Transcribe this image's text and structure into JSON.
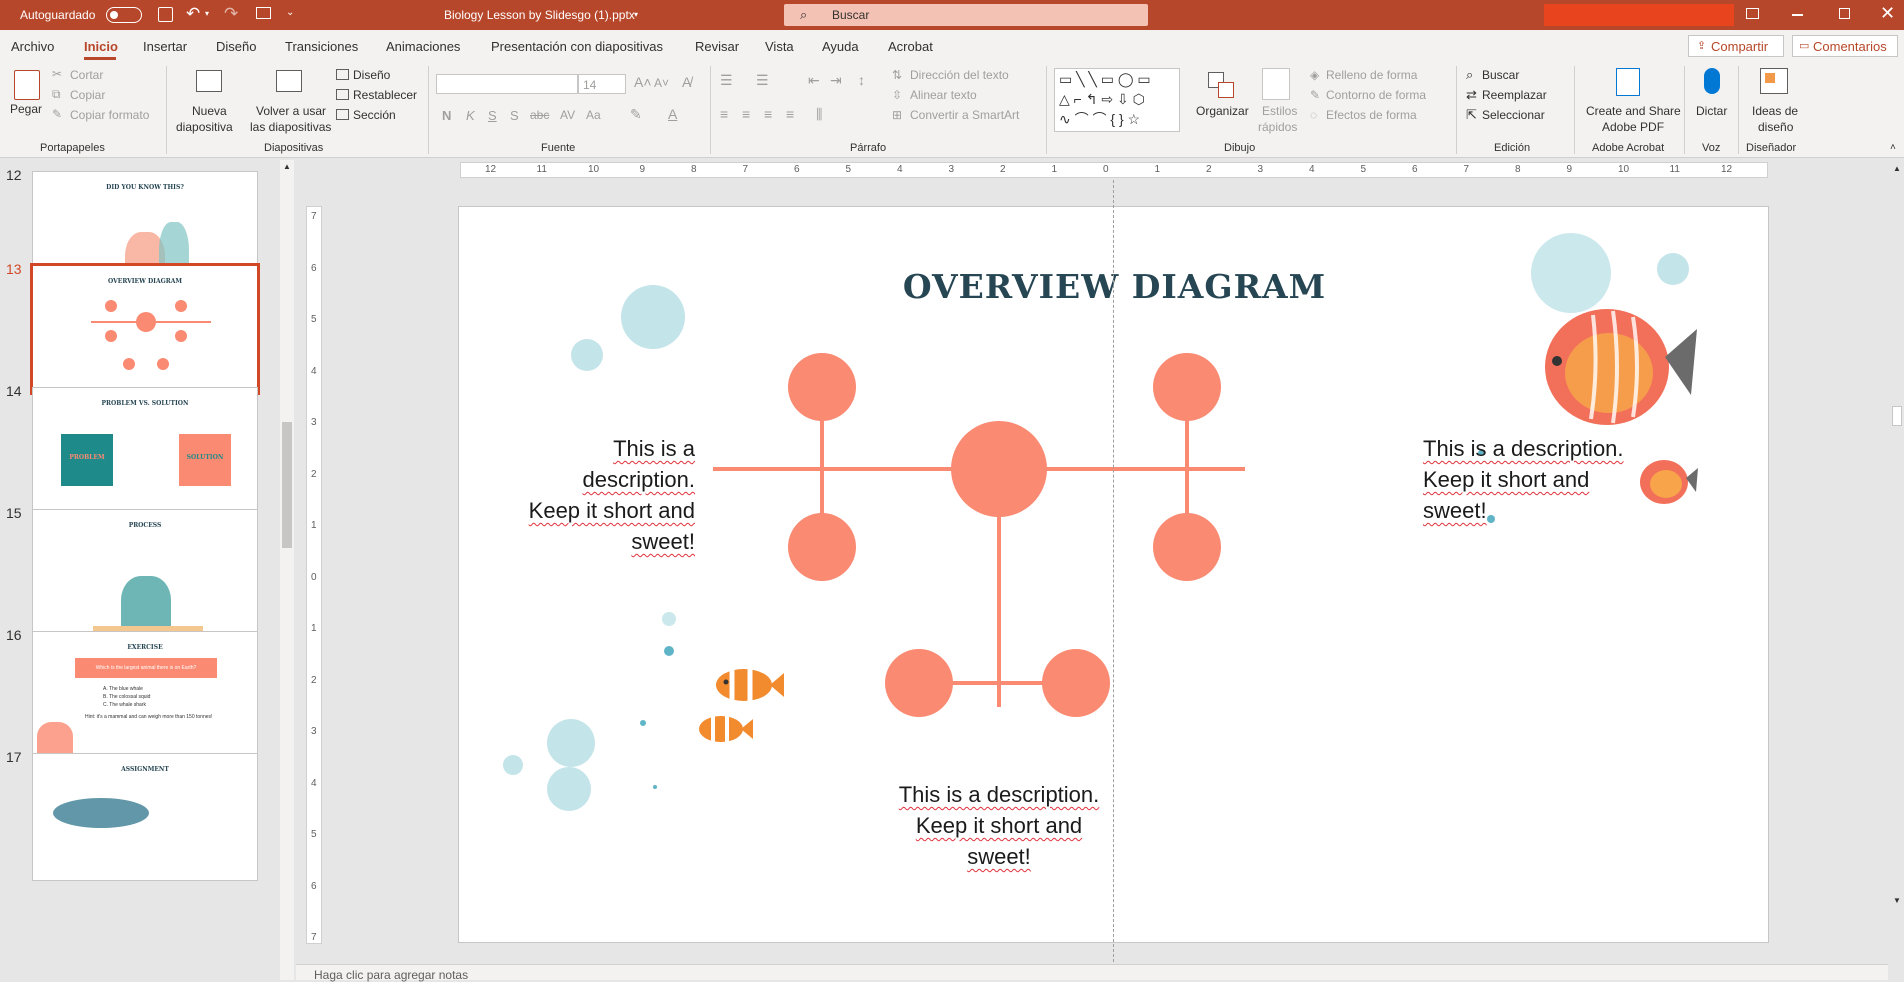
{
  "app": {
    "autosave_label": "Autoguardado",
    "doc_title": "Biology Lesson by Slidesgo (1).pptx",
    "search_placeholder": "Buscar",
    "accent": "#b7472a"
  },
  "tabs": [
    "Archivo",
    "Inicio",
    "Insertar",
    "Diseño",
    "Transiciones",
    "Animaciones",
    "Presentación con diapositivas",
    "Revisar",
    "Vista",
    "Ayuda",
    "Acrobat"
  ],
  "share": {
    "share_label": "Compartir",
    "comments_label": "Comentarios"
  },
  "ribbon": {
    "portapapeles": {
      "paste": "Pegar",
      "cut": "Cortar",
      "copy": "Copiar",
      "format": "Copiar formato",
      "group": "Portapapeles"
    },
    "diapositivas": {
      "new": "Nueva",
      "new2": "diapositiva",
      "reuse": "Volver a usar",
      "reuse2": "las diapositivas",
      "layout": "Diseño",
      "reset": "Restablecer",
      "section": "Sección",
      "group": "Diapositivas"
    },
    "fuente": {
      "size": "14",
      "group": "Fuente"
    },
    "parrafo": {
      "direction": "Dirección del texto",
      "align": "Alinear texto",
      "smartart": "Convertir a SmartArt",
      "group": "Párrafo"
    },
    "dibujo": {
      "arrange": "Organizar",
      "styles": "Estilos",
      "styles2": "rápidos",
      "fill": "Relleno de forma",
      "outline": "Contorno de forma",
      "effects": "Efectos de forma",
      "group": "Dibujo"
    },
    "edicion": {
      "find": "Buscar",
      "replace": "Reemplazar",
      "select": "Seleccionar",
      "group": "Edición"
    },
    "acrobat": {
      "create": "Create and Share",
      "create2": "Adobe PDF",
      "group": "Adobe Acrobat"
    },
    "voz": {
      "dictate": "Dictar",
      "group": "Voz"
    },
    "disenador": {
      "ideas": "Ideas de",
      "ideas2": "diseño",
      "group": "Diseñador"
    }
  },
  "thumbnails": [
    {
      "num": "12",
      "title": "DID YOU KNOW THIS?"
    },
    {
      "num": "13",
      "title": "OVERVIEW DIAGRAM"
    },
    {
      "num": "14",
      "title": "PROBLEM VS. SOLUTION",
      "left": "PROBLEM",
      "right": "SOLUTION"
    },
    {
      "num": "15",
      "title": "PROCESS"
    },
    {
      "num": "16",
      "title": "EXERCISE",
      "question": "Which is the largest animal there is on Earth?",
      "options": [
        "A. The blue whale",
        "B. The colossal squid",
        "C. The whale shark"
      ],
      "hint": "Hint: it's a mammal and can weigh more than 150 tonnes!"
    },
    {
      "num": "17",
      "title": "ASSIGNMENT"
    }
  ],
  "slide": {
    "title": "OVERVIEW DIAGRAM",
    "desc_left": [
      "This is a description.",
      "Keep it short and",
      "sweet!"
    ],
    "desc_right": [
      "This is a description.",
      "Keep it short and",
      "sweet!"
    ],
    "desc_bottom": [
      "This is a description.",
      "Keep it short and",
      "sweet!"
    ],
    "accent": "#fa8a72",
    "title_color": "#264653"
  },
  "rulers": {
    "h": [
      "12",
      "11",
      "10",
      "9",
      "8",
      "7",
      "6",
      "5",
      "4",
      "3",
      "2",
      "1",
      "0",
      "1",
      "2",
      "3",
      "4",
      "5",
      "6",
      "7",
      "8",
      "9",
      "10",
      "11",
      "12"
    ],
    "v": [
      "7",
      "6",
      "5",
      "4",
      "3",
      "2",
      "1",
      "0",
      "1",
      "2",
      "3",
      "4",
      "5",
      "6",
      "7"
    ]
  },
  "notes_placeholder": "Haga clic para agregar notas"
}
